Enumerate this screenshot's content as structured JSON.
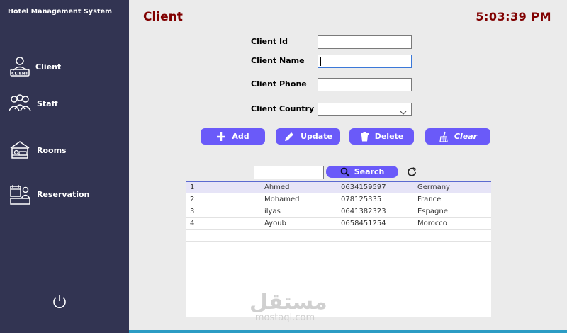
{
  "app_title": "Hotel Management System",
  "sidebar": {
    "items": [
      {
        "label": "Client",
        "icon": "client-icon"
      },
      {
        "label": "Staff",
        "icon": "staff-icon"
      },
      {
        "label": "Rooms",
        "icon": "rooms-icon"
      },
      {
        "label": "Reservation",
        "icon": "reservation-icon"
      }
    ],
    "client_icon_text": "CLIENT",
    "power_icon": "power-icon"
  },
  "header": {
    "title": "Client",
    "clock": "5:03:39 PM"
  },
  "form": {
    "client_id_label": "Client Id",
    "client_id_value": "",
    "client_name_label": "Client Name",
    "client_name_value": "",
    "client_phone_label": "Client Phone",
    "client_phone_value": "",
    "client_country_label": "Client Country",
    "client_country_value": ""
  },
  "buttons": {
    "add": "Add",
    "update": "Update",
    "delete": "Delete",
    "clear": "Clear"
  },
  "search": {
    "value": "",
    "button": "Search"
  },
  "table": {
    "rows": [
      {
        "id": "1",
        "name": "Ahmed",
        "phone": "0634159597",
        "country": "Germany",
        "selected": true
      },
      {
        "id": "2",
        "name": "Mohamed",
        "phone": "078125335",
        "country": "France",
        "selected": false
      },
      {
        "id": "3",
        "name": "ilyas",
        "phone": "0641382323",
        "country": "Espagne",
        "selected": false
      },
      {
        "id": "4",
        "name": "Ayoub",
        "phone": "0658451254",
        "country": "Morocco",
        "selected": false
      }
    ]
  },
  "watermark": {
    "arabic": "مستقل",
    "latin": "mostaql.com"
  },
  "colors": {
    "sidebar_bg": "#323452",
    "accent": "#6a5af9",
    "title": "#800000",
    "content_bg": "#ebebeb"
  }
}
